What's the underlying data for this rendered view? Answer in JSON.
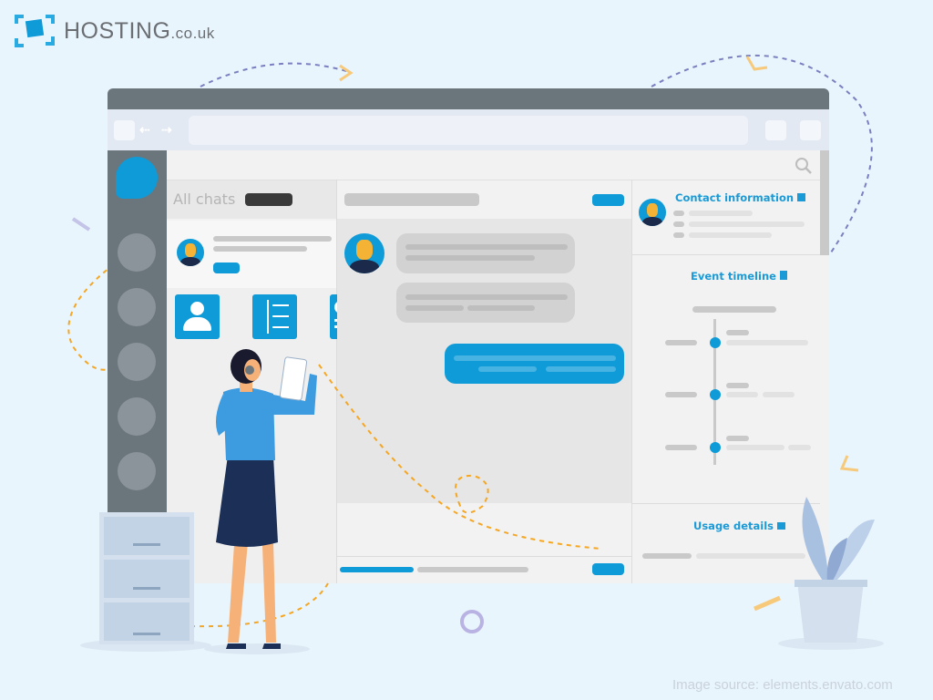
{
  "brand": {
    "name": "HOSTING",
    "domain_suffix": ".co.uk",
    "colors": {
      "accent": "#0f9bd7",
      "frame": "#6b757c",
      "background": "#e9f5fd"
    }
  },
  "chat_list": {
    "title": "All chats"
  },
  "contact_panel": {
    "title": "Contact information",
    "icon": "contact-card-icon"
  },
  "timeline_panel": {
    "title": "Event timeline",
    "icon": "list-icon"
  },
  "usage_panel": {
    "title": "Usage details",
    "icon": "chart-icon"
  },
  "toolbar": {
    "search_icon": "search-icon",
    "nav_icons": [
      "back-arrow-icon",
      "forward-arrow-icon"
    ]
  },
  "watermark": "Image source: elements.envato.com"
}
